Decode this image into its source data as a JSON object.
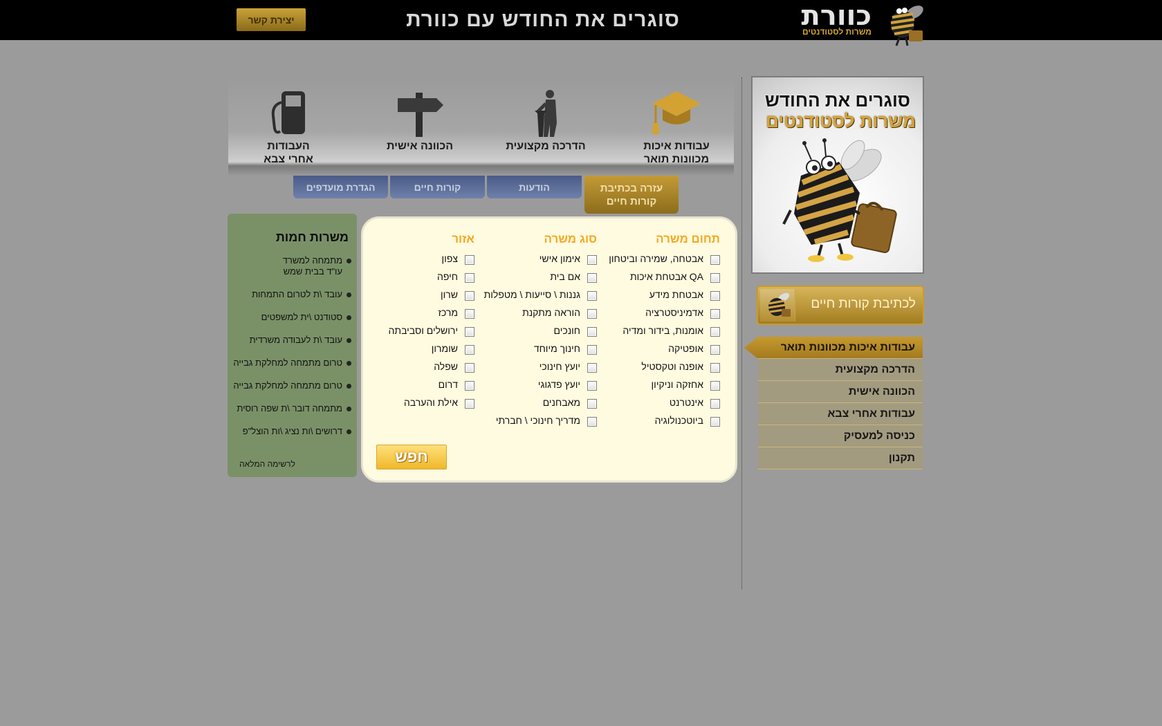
{
  "header": {
    "contact_label": "יצירת קשר",
    "slogan": "סוגרים את החודש עם כוורת",
    "logo_text": "כוורת",
    "logo_subtitle": "משרות לסטודנטים"
  },
  "promo": {
    "line1": "סוגרים את החודש",
    "line2": "משרות לסטודנטים"
  },
  "cv_button": {
    "label": "לכתיבת קורות חיים"
  },
  "side_menu": [
    {
      "label": "עבודות איכות מכוונות תואר"
    },
    {
      "label": "הדרכה מקצועית"
    },
    {
      "label": "הכוונה אישית"
    },
    {
      "label": "עבודות אחרי צבא"
    },
    {
      "label": "כניסה למעסיק"
    },
    {
      "label": "תקנון"
    }
  ],
  "categories": [
    {
      "line1": "עבודות איכות",
      "line2": "מכוונות תואר",
      "icon": "graduation-cap-icon"
    },
    {
      "line1": "הדרכה מקצועית",
      "line2": "",
      "icon": "lecturer-podium-icon"
    },
    {
      "line1": "הכוונה אישית",
      "line2": "",
      "icon": "signpost-icon"
    },
    {
      "line1": "העבודות",
      "line2": "אחרי צבא",
      "icon": "fuel-pump-icon"
    }
  ],
  "tabs": [
    {
      "line1": "עזרה בכתיבת",
      "line2": "קורות חיים"
    },
    {
      "label": "הודעות"
    },
    {
      "label": "קורות חיים"
    },
    {
      "label": "הגדרת מועדפים"
    }
  ],
  "search": {
    "field_title": "תחום משרה",
    "fields": [
      "אבטחה, שמירה וביטחון",
      "אבטחת איכות QA",
      "אבטחת מידע",
      "אדמיניסטרציה",
      "אומנות, בידור ומדיה",
      "אופטיקה",
      "אופנה וטקסטיל",
      "אחזקה וניקיון",
      "אינטרנט",
      "ביוטכנולוגיה"
    ],
    "type_title": "סוג משרה",
    "types": [
      "אימון אישי",
      "אם בית",
      "גננות \\ סייעות \\ מטפלות",
      "הוראה מתקנת",
      "חונכים",
      "חינוך מיוחד",
      "יועץ חינוכי",
      "יועץ פדגוגי",
      "מאבחנים",
      "מדריך חינוכי \\ חברתי"
    ],
    "area_title": "אזור",
    "areas": [
      "צפון",
      "חיפה",
      "שרון",
      "מרכז",
      "ירושלים וסביבתה",
      "שומרון",
      "שפלה",
      "דרום",
      "אילת והערבה"
    ],
    "button_label": "חפש"
  },
  "hot_jobs": {
    "title": "משרות חמות",
    "items": [
      {
        "line1": "מתמחה למשרד",
        "line2": "עו\"ד בבית שמש"
      },
      {
        "line1": "עובד \\ת לטרום התמחות"
      },
      {
        "line1": "סטודנט \\ית למשפטים"
      },
      {
        "line1": "עובד \\ת לעבודה משרדית"
      },
      {
        "line1": "טרום מתמחה למחלקת גבייה"
      },
      {
        "line1": "טרום מתמחה למחלקת גבייה"
      },
      {
        "line1": "מתמחה דובר \\ת שפה רוסית"
      },
      {
        "line1": "דרושים \\ות נציג \\ות הוצל\"פ"
      }
    ],
    "more_label": "לרשימה המלאה"
  },
  "colors": {
    "topbar": "#000000",
    "gold": "#c9a33a",
    "search_title": "#f5a722",
    "hot_jobs_bg": "#7a9168",
    "tab_blue": "#4a5b88",
    "page_bg": "#9b9b9b"
  }
}
